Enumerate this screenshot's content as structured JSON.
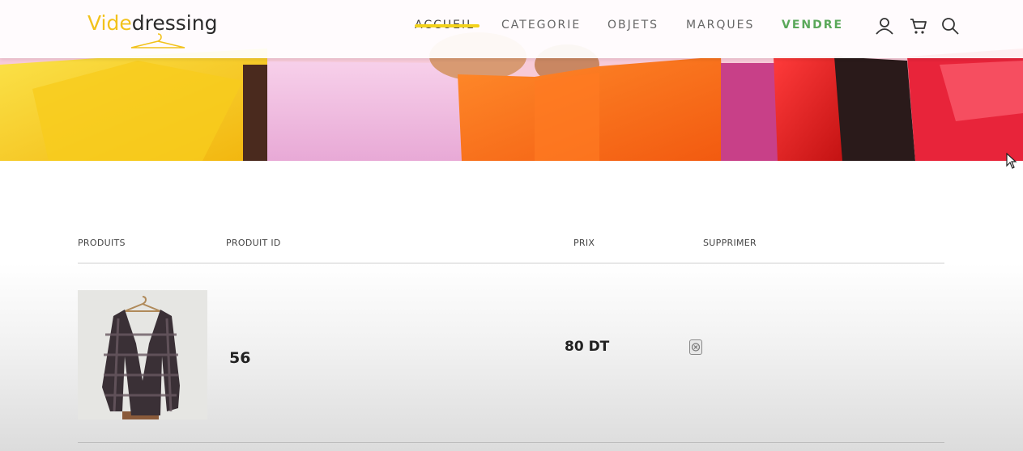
{
  "brand": {
    "logo_part1": "Vide",
    "logo_part2": "dressing",
    "accent_color": "#f2c21b"
  },
  "nav": {
    "items": [
      {
        "label": "ACCUEIL",
        "active": true
      },
      {
        "label": "CATEGORIE"
      },
      {
        "label": "OBJETS"
      },
      {
        "label": "MARQUES"
      },
      {
        "label": "VENDRE",
        "color": "#5aa85a"
      }
    ],
    "icons": [
      "user-icon",
      "cart-icon",
      "search-icon"
    ]
  },
  "hero": {
    "image": "shopping-bags-banner"
  },
  "cart": {
    "headers": {
      "product": "PRODUITS",
      "product_id": "PRODUIT ID",
      "price": "PRIX",
      "delete": "SUPPRIMER"
    },
    "rows": [
      {
        "image": "coat-photo",
        "product_id": "56",
        "price": "80 DT",
        "delete_icon": "close-icon"
      }
    ]
  }
}
